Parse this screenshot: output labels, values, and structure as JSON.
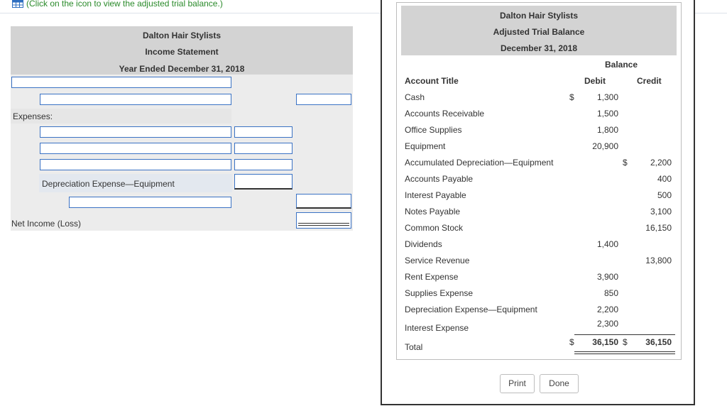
{
  "instruction_link": "(Click on the icon to view the adjusted trial balance.)",
  "income_statement": {
    "company": "Dalton Hair Stylists",
    "statement": "Income Statement",
    "period": "Year Ended December 31, 2018",
    "expenses_label": "Expenses:",
    "depreciation_label": "Depreciation Expense—Equipment",
    "net_income_label": "Net Income (Loss)"
  },
  "trial_balance": {
    "company": "Dalton Hair Stylists",
    "title": "Adjusted Trial Balance",
    "date": "December 31, 2018",
    "balance_header": "Balance",
    "col_account": "Account Title",
    "col_debit": "Debit",
    "col_credit": "Credit",
    "rows": [
      {
        "account": "Cash",
        "debit_sign": "$",
        "debit": "1,300",
        "credit_sign": "",
        "credit": ""
      },
      {
        "account": "Accounts Receivable",
        "debit_sign": "",
        "debit": "1,500",
        "credit_sign": "",
        "credit": ""
      },
      {
        "account": "Office Supplies",
        "debit_sign": "",
        "debit": "1,800",
        "credit_sign": "",
        "credit": ""
      },
      {
        "account": "Equipment",
        "debit_sign": "",
        "debit": "20,900",
        "credit_sign": "",
        "credit": ""
      },
      {
        "account": "Accumulated Depreciation—Equipment",
        "debit_sign": "",
        "debit": "",
        "credit_sign": "$",
        "credit": "2,200"
      },
      {
        "account": "Accounts Payable",
        "debit_sign": "",
        "debit": "",
        "credit_sign": "",
        "credit": "400"
      },
      {
        "account": "Interest Payable",
        "debit_sign": "",
        "debit": "",
        "credit_sign": "",
        "credit": "500"
      },
      {
        "account": "Notes Payable",
        "debit_sign": "",
        "debit": "",
        "credit_sign": "",
        "credit": "3,100"
      },
      {
        "account": "Common Stock",
        "debit_sign": "",
        "debit": "",
        "credit_sign": "",
        "credit": "16,150"
      },
      {
        "account": "Dividends",
        "debit_sign": "",
        "debit": "1,400",
        "credit_sign": "",
        "credit": ""
      },
      {
        "account": "Service Revenue",
        "debit_sign": "",
        "debit": "",
        "credit_sign": "",
        "credit": "13,800"
      },
      {
        "account": "Rent Expense",
        "debit_sign": "",
        "debit": "3,900",
        "credit_sign": "",
        "credit": ""
      },
      {
        "account": "Supplies Expense",
        "debit_sign": "",
        "debit": "850",
        "credit_sign": "",
        "credit": ""
      },
      {
        "account": "Depreciation Expense—Equipment",
        "debit_sign": "",
        "debit": "2,200",
        "credit_sign": "",
        "credit": ""
      },
      {
        "account": "Interest Expense",
        "debit_sign": "",
        "debit": "2,300",
        "credit_sign": "",
        "credit": ""
      }
    ],
    "total": {
      "account": "Total",
      "debit_sign": "$",
      "debit": "36,150",
      "credit_sign": "$",
      "credit": "36,150"
    }
  },
  "buttons": {
    "print": "Print",
    "done": "Done"
  }
}
